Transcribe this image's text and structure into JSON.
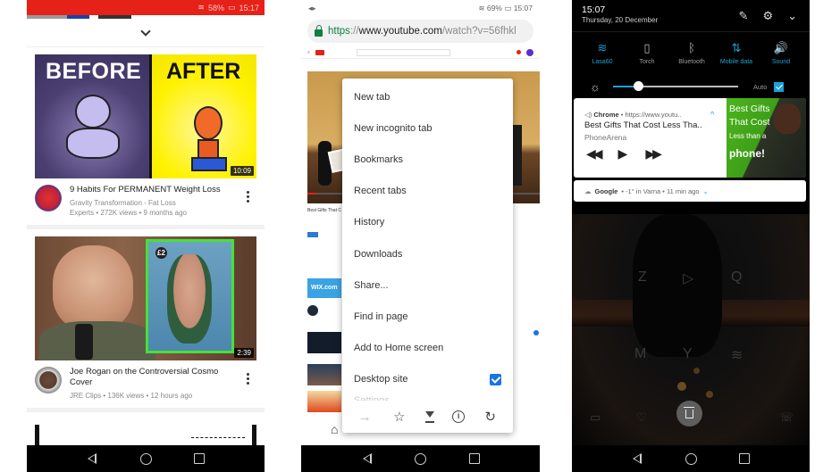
{
  "youtube_panel": {
    "status_bar": {
      "signal": "58%",
      "time": "15:17"
    },
    "videos": [
      {
        "thumbnail_text_left": "BEFORE",
        "thumbnail_text_right": "AFTER",
        "duration": "10:09",
        "title": "9 Habits For PERMANENT Weight Loss",
        "channel_line": "Gravity Transformation - Fat Loss",
        "stats_line": "Experts • 272K views • 9 months ago"
      },
      {
        "thumbnail_text_left": "",
        "thumbnail_text_right": "£2",
        "duration": "2:39",
        "title": "Joe Rogan on the Controversial Cosmo Cover",
        "channel_line": "",
        "stats_line": "JRE Clips • 136K views • 12 hours ago"
      }
    ],
    "nav": {
      "back": "back-icon",
      "home": "home-icon",
      "recents": "recents-icon"
    }
  },
  "chrome_panel": {
    "status_bar": {
      "signal": "69%",
      "time": "15:07"
    },
    "url": {
      "scheme": "https",
      "separator": "://",
      "host": "www.youtube.com",
      "path": "/watch?v=56fhkl"
    },
    "page_bits": {
      "wix": "WIX.com"
    },
    "menu_items": [
      {
        "label": "New tab"
      },
      {
        "label": "New incognito tab"
      },
      {
        "label": "Bookmarks"
      },
      {
        "label": "Recent tabs"
      },
      {
        "label": "History"
      },
      {
        "label": "Downloads"
      },
      {
        "label": "Share..."
      },
      {
        "label": "Find in page"
      },
      {
        "label": "Add to Home screen"
      },
      {
        "label": "Desktop site",
        "checked": true
      },
      {
        "label": "Settings"
      }
    ],
    "menu_toolbar": {
      "forward": "→",
      "bookmark": "☆",
      "download": "download-icon",
      "info": "i",
      "reload": "↻"
    },
    "home_glyph": "⌂"
  },
  "notification_panel": {
    "time": "15:07",
    "date": "Thursday, 20 December",
    "header_icons": {
      "edit": "✎",
      "settings": "⚙",
      "collapse": "⌄"
    },
    "tiles": [
      {
        "label": "Lasa60",
        "icon": "wifi-icon",
        "glyph": "≋",
        "active": true
      },
      {
        "label": "Torch",
        "icon": "torch-icon",
        "glyph": "▯",
        "active": false
      },
      {
        "label": "Bluetooth",
        "icon": "bluetooth-icon",
        "glyph": "ᛒ",
        "active": false
      },
      {
        "label": "Mobile data",
        "icon": "mobile-data-icon",
        "glyph": "⇅",
        "active": true
      },
      {
        "label": "Sound",
        "icon": "sound-icon",
        "glyph": "🔊",
        "active": true
      }
    ],
    "brightness": {
      "level_percent": 20,
      "auto_label": "Auto",
      "auto_checked": true
    },
    "media": {
      "app": "Chrome",
      "source": "• https://www.youtu..",
      "title": "Best Gifts That Cost Less Tha..",
      "artist": "PhoneArena",
      "controls": {
        "prev": "◀◀",
        "play": "▶",
        "next": "▶▶"
      },
      "art_lines": [
        "Best Gifts",
        "That Cost",
        "Less than a",
        "phone!"
      ],
      "expand": "^"
    },
    "google_notification": {
      "app": "Google",
      "text": "• -1° in Varna • 11 min ago",
      "expand": "⌄"
    },
    "wallpaper_icons": [
      "Z",
      "▷",
      "Q",
      "M",
      "Y",
      "≋"
    ],
    "dock_icons": [
      "▭",
      "♡",
      "☏"
    ]
  }
}
